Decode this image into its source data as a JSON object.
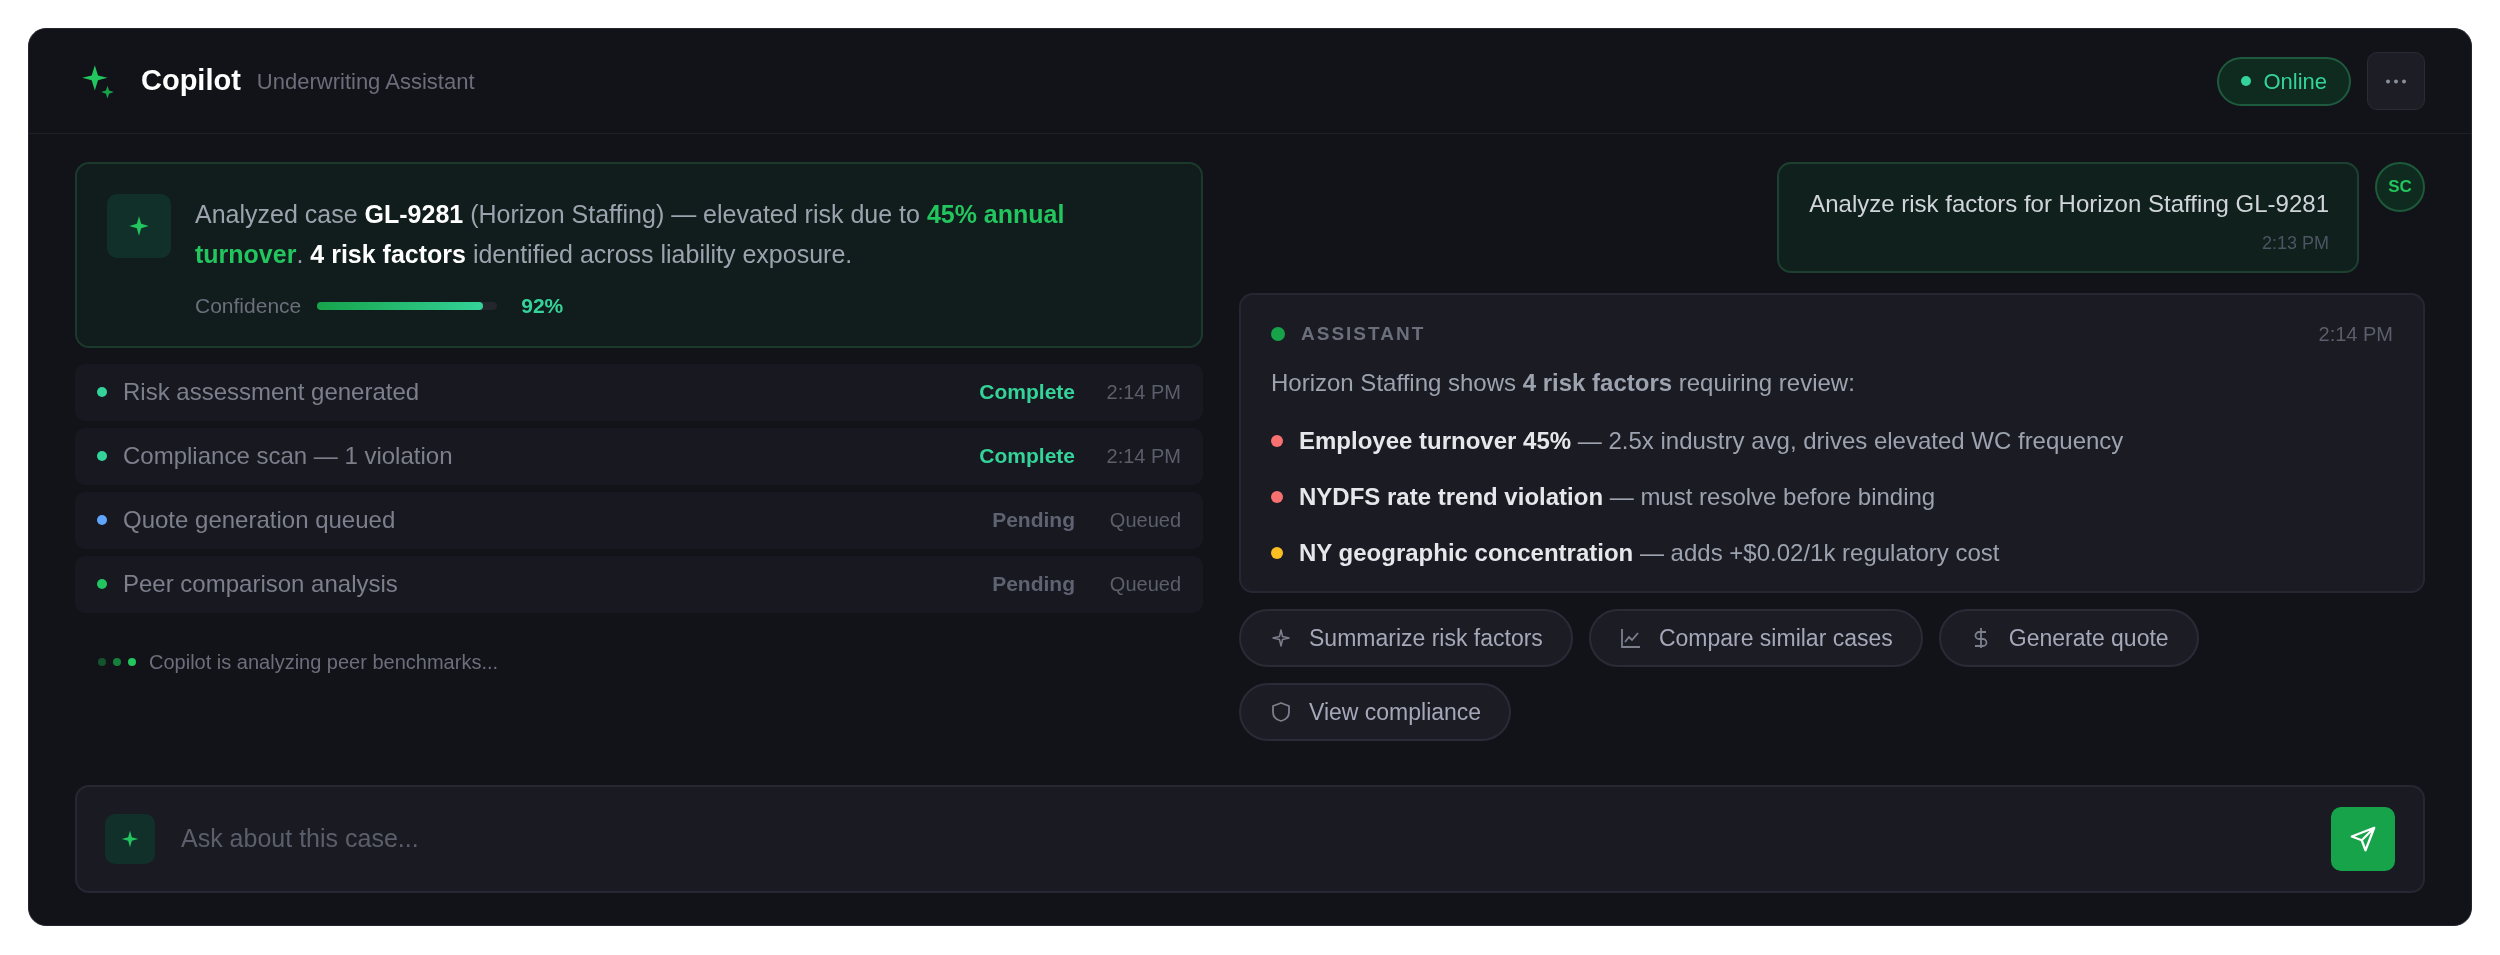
{
  "header": {
    "title": "Copilot",
    "subtitle": "Underwriting Assistant",
    "status": {
      "label": "Online",
      "online": true
    }
  },
  "summary": {
    "parts": [
      {
        "text": "Analyzed case ",
        "kind": "plain"
      },
      {
        "text": "GL-9281",
        "kind": "bold"
      },
      {
        "text": " (Horizon Staffing) — elevated risk due to ",
        "kind": "plain"
      },
      {
        "text": "45% annual turnover",
        "kind": "highlight"
      },
      {
        "text": ". ",
        "kind": "plain"
      },
      {
        "text": "4 risk factors",
        "kind": "bold"
      },
      {
        "text": " identified across liability exposure.",
        "kind": "plain"
      }
    ],
    "confidence_label": "Confidence",
    "level": 0.92,
    "reading": "92%"
  },
  "tasks": [
    {
      "label": "Risk assessment generated",
      "status": "Complete",
      "done": true,
      "time": "2:14 PM",
      "color": "#34d399"
    },
    {
      "label": "Compliance scan — 1 violation",
      "status": "Complete",
      "done": true,
      "time": "2:14 PM",
      "color": "#34d399"
    },
    {
      "label": "Quote generation queued",
      "status": "Pending",
      "done": false,
      "time": "Queued",
      "color": "#60a5fa"
    },
    {
      "label": "Peer comparison analysis",
      "status": "Pending",
      "done": false,
      "time": "Queued",
      "color": "#22c55e"
    }
  ],
  "typing": {
    "text": "Copilot is analyzing peer benchmarks..."
  },
  "user_message": {
    "initials": "SC",
    "text": "Analyze risk factors for Horizon Staffing GL-9281",
    "time": "2:13 PM"
  },
  "assistant": {
    "label": "ASSISTANT",
    "time": "2:14 PM",
    "intro": "Horizon Staffing shows **4 risk factors** requiring review:",
    "factors": [
      {
        "title": "Employee turnover 45%",
        "detail": " — 2.5x industry avg, drives elevated WC frequency",
        "color": "#f87171"
      },
      {
        "title": "NYDFS rate trend violation",
        "detail": " — must resolve before binding",
        "color": "#f87171"
      },
      {
        "title": "NY geographic concentration",
        "detail": " — adds +$0.02/1k regulatory cost",
        "color": "#fbbf24"
      }
    ]
  },
  "suggestions": [
    {
      "label": "Summarize risk factors",
      "kind": "sparkle"
    },
    {
      "label": "Compare similar cases",
      "kind": "chart"
    },
    {
      "label": "Generate quote",
      "kind": "dollar"
    },
    {
      "label": "View compliance",
      "kind": "shield"
    }
  ],
  "composer": {
    "placeholder": "Ask about this case..."
  }
}
